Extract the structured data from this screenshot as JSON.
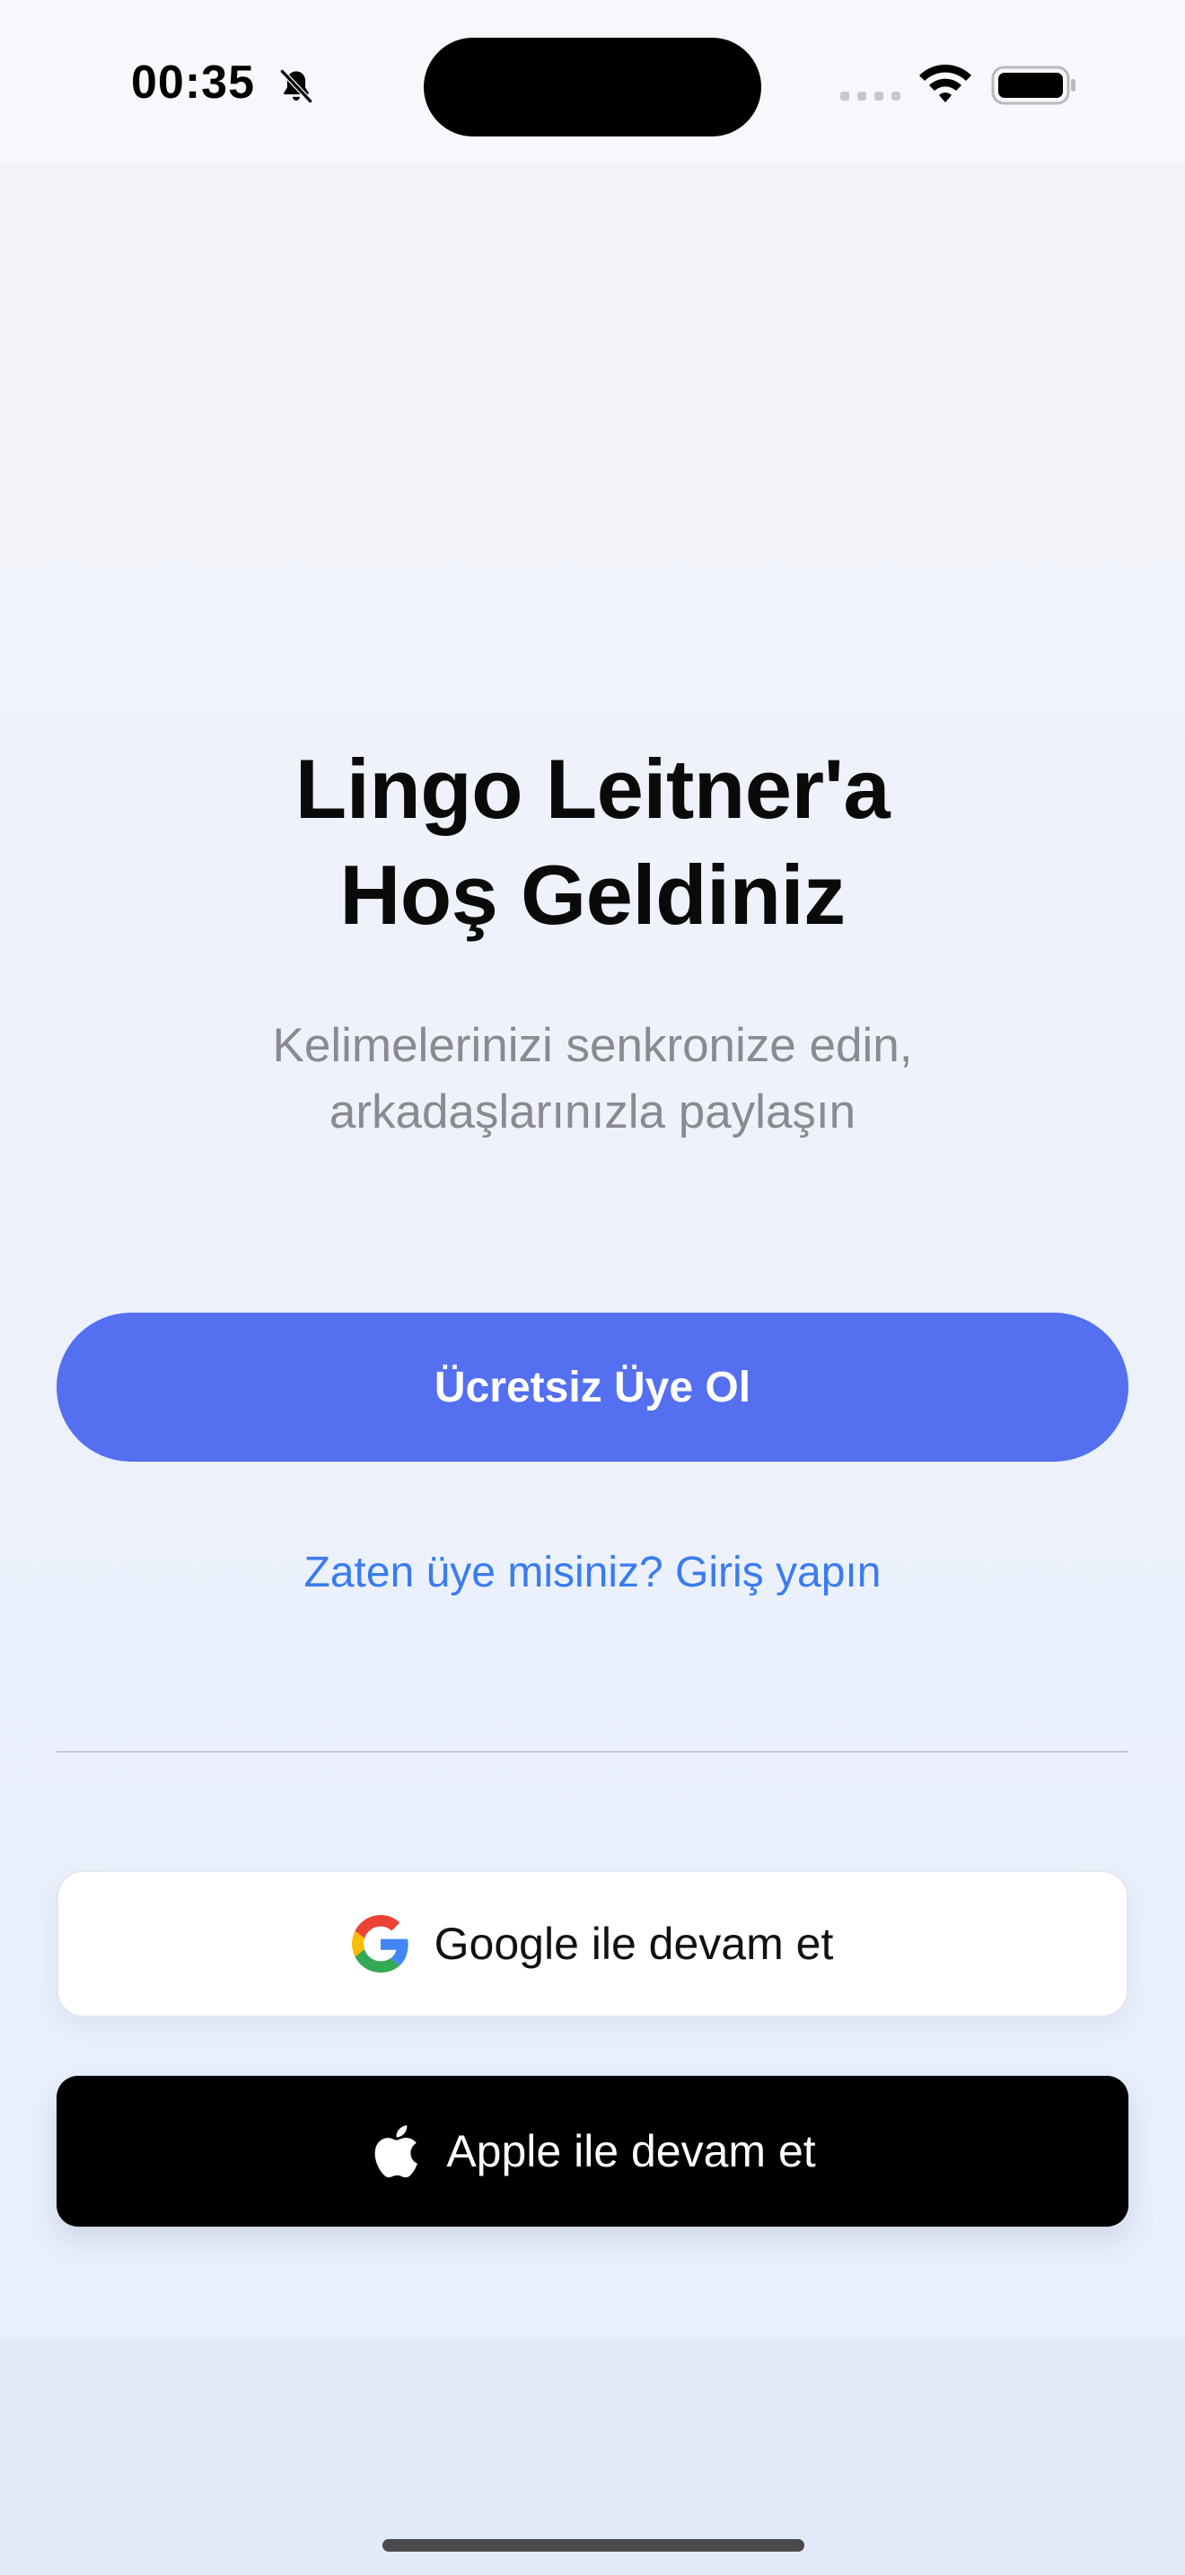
{
  "status_bar": {
    "time": "00:35",
    "icons": {
      "silent": "bell-slash-icon",
      "signal": "cellular-signal-icon",
      "wifi": "wifi-icon",
      "battery": "battery-icon"
    }
  },
  "welcome": {
    "title_line1": "Lingo Leitner'a",
    "title_line2": "Hoş Geldiniz",
    "subtitle_line1": "Kelimelerinizi senkronize edin,",
    "subtitle_line2": "arkadaşlarınızla paylaşın"
  },
  "actions": {
    "signup_label": "Ücretsiz Üye Ol",
    "login_link": "Zaten üye misiniz? Giriş yapın",
    "google_label": "Google ile devam et",
    "apple_label": "Apple ile devam et"
  },
  "colors": {
    "primary": "#5470f0",
    "link": "#3a7cf0",
    "apple_button": "#000000",
    "google_button": "#ffffff"
  }
}
